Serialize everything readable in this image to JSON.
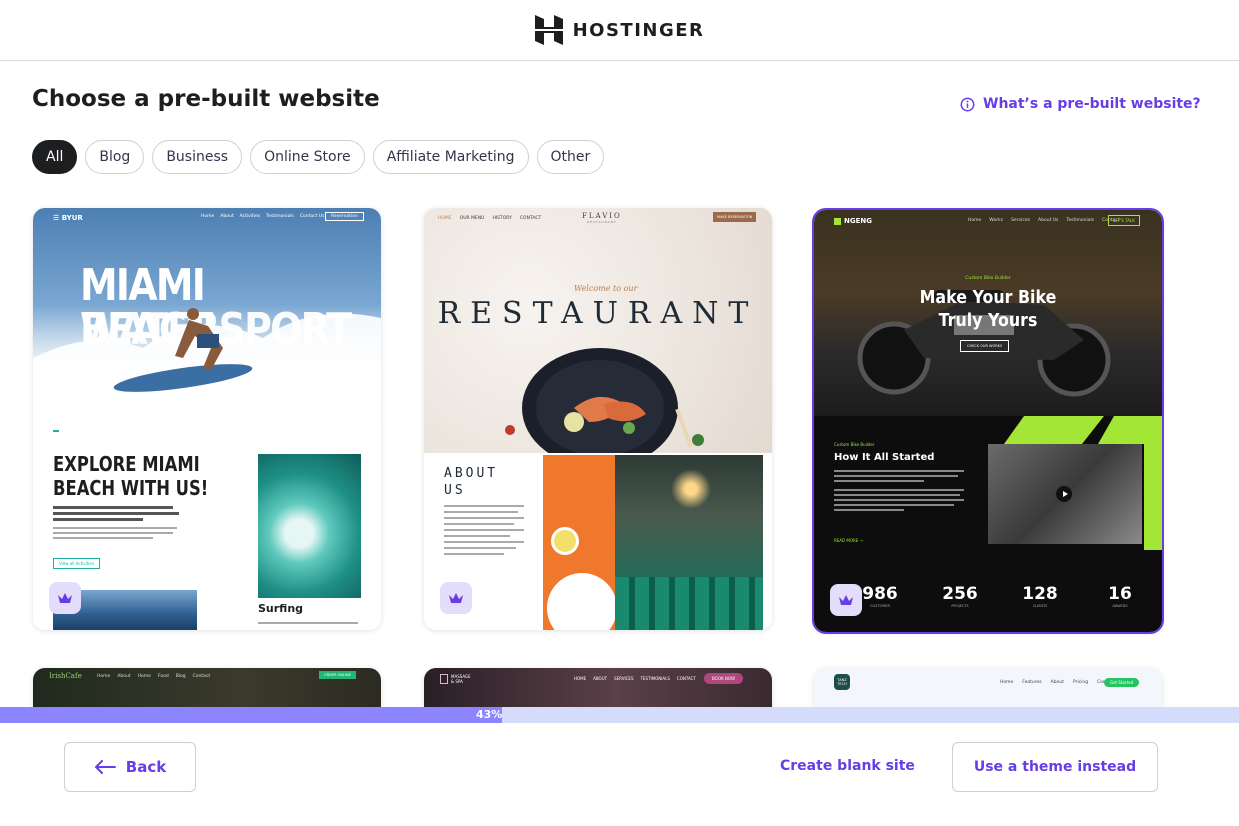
{
  "header": {
    "brand": "HOSTINGER"
  },
  "page": {
    "title": "Choose a pre-built website",
    "help_link": "What’s a pre-built website?"
  },
  "filters": [
    "All",
    "Blog",
    "Business",
    "Online Store",
    "Affiliate Marketing",
    "Other"
  ],
  "templates": [
    {
      "logo": "BYUR",
      "nav": [
        "Home",
        "About",
        "Activities",
        "Testimonials",
        "Contact Us"
      ],
      "cta": "Reservation",
      "hero_title_1": "MIAMI BEACH",
      "hero_title_2": "WATERSPORT",
      "section_title_1": "EXPLORE MIAMI",
      "section_title_2": "BEACH WITH US!",
      "section_button": "View all Activities",
      "caption": "Surfing"
    },
    {
      "nav": [
        "HOME",
        "OUR MENU",
        "HISTORY",
        "CONTACT"
      ],
      "logo": "FLAVIO",
      "logo_sub": "RESTAURANT",
      "cta": "MAKE RESERVATION",
      "tagline": "Welcome to our",
      "hero_title": "RESTAURANT",
      "about_1": "ABOUT",
      "about_2": "US"
    },
    {
      "logo": "NGENG",
      "nav": [
        "Home",
        "Works",
        "Services",
        "About Us",
        "Testimonials",
        "Contact"
      ],
      "cta": "LET'S TALK",
      "kicker": "Custom Bike Builder",
      "hero_1": "Make Your Bike",
      "hero_2": "Truly Yours",
      "hero_button": "CHECK OUR WORKS",
      "section_kicker": "Custom Bike Builder",
      "section_title": "How It All Started",
      "read_more": "READ MORE",
      "stats": [
        {
          "value": "986",
          "label": "CUSTOMER"
        },
        {
          "value": "256",
          "label": "PROJECTS"
        },
        {
          "value": "128",
          "label": "CLIENTS"
        },
        {
          "value": "16",
          "label": "AWARDS"
        }
      ]
    },
    {
      "logo": "IrishCafe",
      "nav": [
        "Home",
        "About",
        "Home",
        "Food",
        "Blog",
        "Contact"
      ],
      "cta": "ORDER ONLINE"
    },
    {
      "logo_1": "MASSAGE",
      "logo_2": "& SPA",
      "nav": [
        "HOME",
        "ABOUT",
        "SERVICES",
        "TESTIMONIALS",
        "CONTACT"
      ],
      "cta": "BOOK NOW"
    },
    {
      "logo": "TANZ TECH",
      "nav": [
        "Home",
        "Features",
        "About",
        "Pricing",
        "Contact"
      ],
      "cta": "Get Started"
    }
  ],
  "progress": {
    "percent": 43,
    "label": "43%"
  },
  "footer": {
    "back": "Back",
    "create_blank": "Create blank site",
    "use_theme": "Use a theme instead"
  },
  "colors": {
    "accent": "#673de6",
    "dark": "#1d1e20",
    "lime": "#a3e635",
    "progress": "#8c85ff"
  }
}
